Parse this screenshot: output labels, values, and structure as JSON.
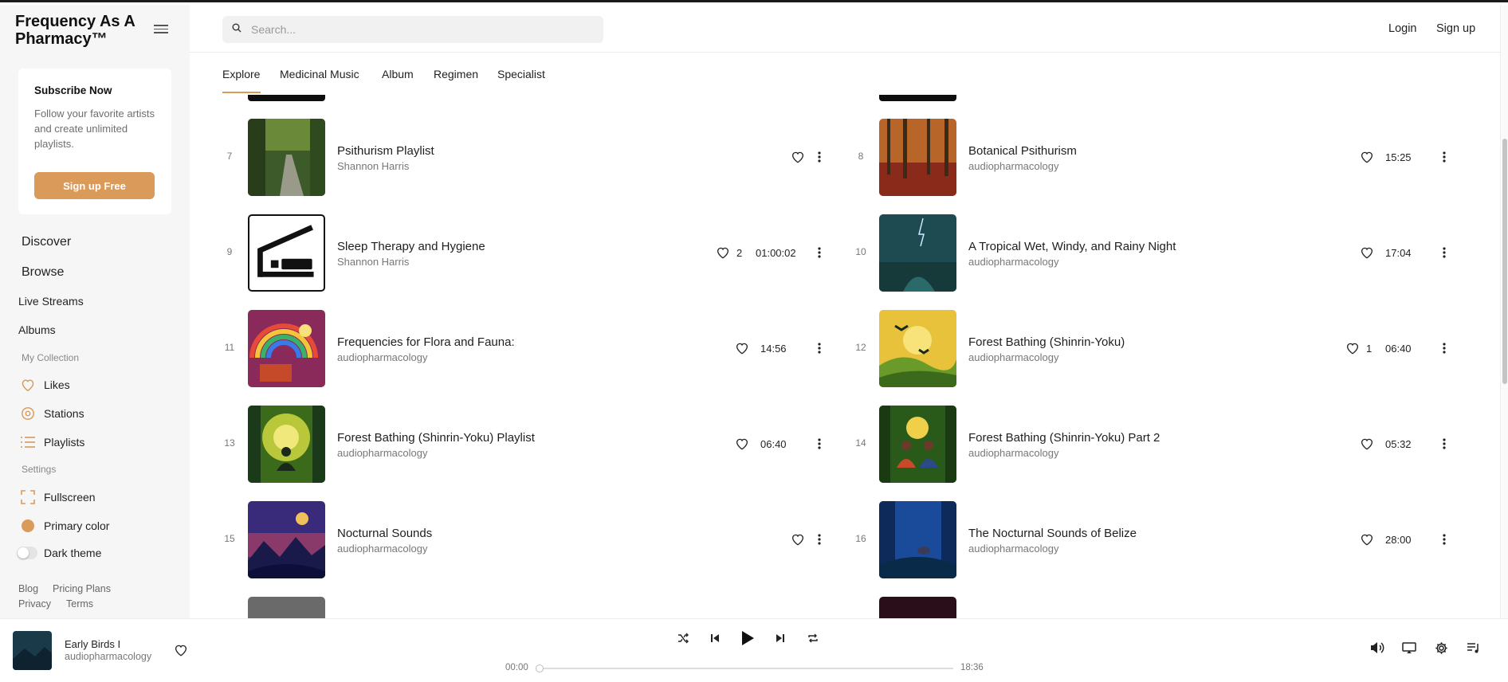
{
  "app": {
    "brand": "Frequency As A Pharmacy™"
  },
  "subscribe": {
    "title": "Subscribe Now",
    "text": "Follow your favorite artists and create unlimited playlists.",
    "button": "Sign up Free"
  },
  "nav": {
    "discover": "Discover",
    "browse": "Browse",
    "live_streams": "Live Streams",
    "albums": "Albums",
    "my_collection": "My Collection",
    "likes": "Likes",
    "stations": "Stations",
    "playlists": "Playlists",
    "settings": "Settings",
    "fullscreen": "Fullscreen",
    "primary_color": "Primary color",
    "dark_theme": "Dark theme"
  },
  "footer": {
    "blog": "Blog",
    "pricing": "Pricing Plans",
    "privacy": "Privacy",
    "terms": "Terms"
  },
  "search": {
    "placeholder": "Search..."
  },
  "auth": {
    "login": "Login",
    "signup": "Sign up"
  },
  "tabs": [
    "Explore",
    "Medicinal Music",
    "Album",
    "Regimen",
    "Specialist"
  ],
  "colors": {
    "accent": "#d99a5a"
  },
  "tracks": [
    {
      "num": "7",
      "title": "Psithurism Playlist",
      "artist": "Shannon Harris",
      "likes": "",
      "duration": ""
    },
    {
      "num": "8",
      "title": "Botanical Psithurism",
      "artist": "audiopharmacology",
      "likes": "",
      "duration": "15:25"
    },
    {
      "num": "9",
      "title": "Sleep Therapy and Hygiene",
      "artist": "Shannon Harris",
      "likes": "2",
      "duration": "01:00:02"
    },
    {
      "num": "10",
      "title": "A Tropical Wet, Windy, and Rainy Night",
      "artist": "audiopharmacology",
      "likes": "",
      "duration": "17:04"
    },
    {
      "num": "11",
      "title": "Frequencies for Flora and Fauna:",
      "artist": "audiopharmacology",
      "likes": "",
      "duration": "14:56"
    },
    {
      "num": "12",
      "title": "Forest Bathing (Shinrin-Yoku)",
      "artist": "audiopharmacology",
      "likes": "1",
      "duration": "06:40"
    },
    {
      "num": "13",
      "title": "Forest Bathing (Shinrin-Yoku) Playlist",
      "artist": "audiopharmacology",
      "likes": "",
      "duration": "06:40"
    },
    {
      "num": "14",
      "title": "Forest Bathing (Shinrin-Yoku) Part 2",
      "artist": "audiopharmacology",
      "likes": "",
      "duration": "05:32"
    },
    {
      "num": "15",
      "title": "Nocturnal Sounds",
      "artist": "audiopharmacology",
      "likes": "",
      "duration": ""
    },
    {
      "num": "16",
      "title": "The Nocturnal Sounds of Belize",
      "artist": "audiopharmacology",
      "likes": "",
      "duration": "28:00"
    }
  ],
  "player": {
    "title": "Early Birds I",
    "artist": "audiopharmacology",
    "current_time": "00:00",
    "total_time": "18:36",
    "progress": 0
  }
}
